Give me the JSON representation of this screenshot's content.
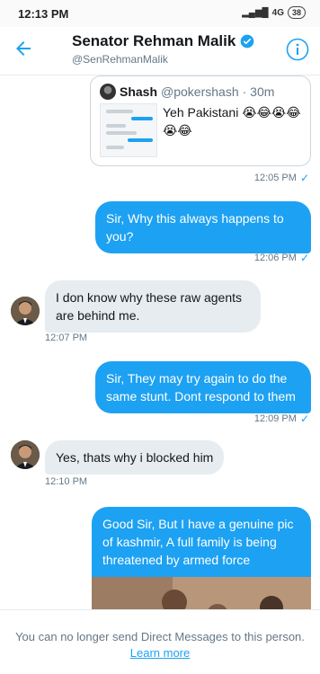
{
  "status_bar": {
    "time": "12:13 PM",
    "network": "4G",
    "battery": "38"
  },
  "header": {
    "name": "Senator Rehman Malik",
    "handle": "@SenRehmanMalik",
    "accent": "#1da1f2"
  },
  "shared_tweet": {
    "author_name": "Shash",
    "author_handle": "@pokershash",
    "time_ago": "· 30m",
    "text": "Yeh Pakistani 😭😂😭😂😭😂",
    "sent_time": "12:05 PM"
  },
  "messages": [
    {
      "direction": "out",
      "text": "Sir, Why this always happens to you?",
      "time": "12:06 PM"
    },
    {
      "direction": "in",
      "text": "I don know why these raw agents are behind me.",
      "time": "12:07 PM"
    },
    {
      "direction": "out",
      "text": "Sir, They may try again to do the same stunt. Dont respond to them",
      "time": "12:09 PM"
    },
    {
      "direction": "in",
      "text": "Yes, thats why i blocked him",
      "time": "12:10 PM"
    },
    {
      "direction": "out",
      "text": "Good Sir, But I have a genuine pic of kashmir, A full family is being threatened by armed force",
      "time": ""
    }
  ],
  "footer": {
    "notice": "You can no longer send Direct Messages to this person.",
    "link": "Learn more"
  }
}
